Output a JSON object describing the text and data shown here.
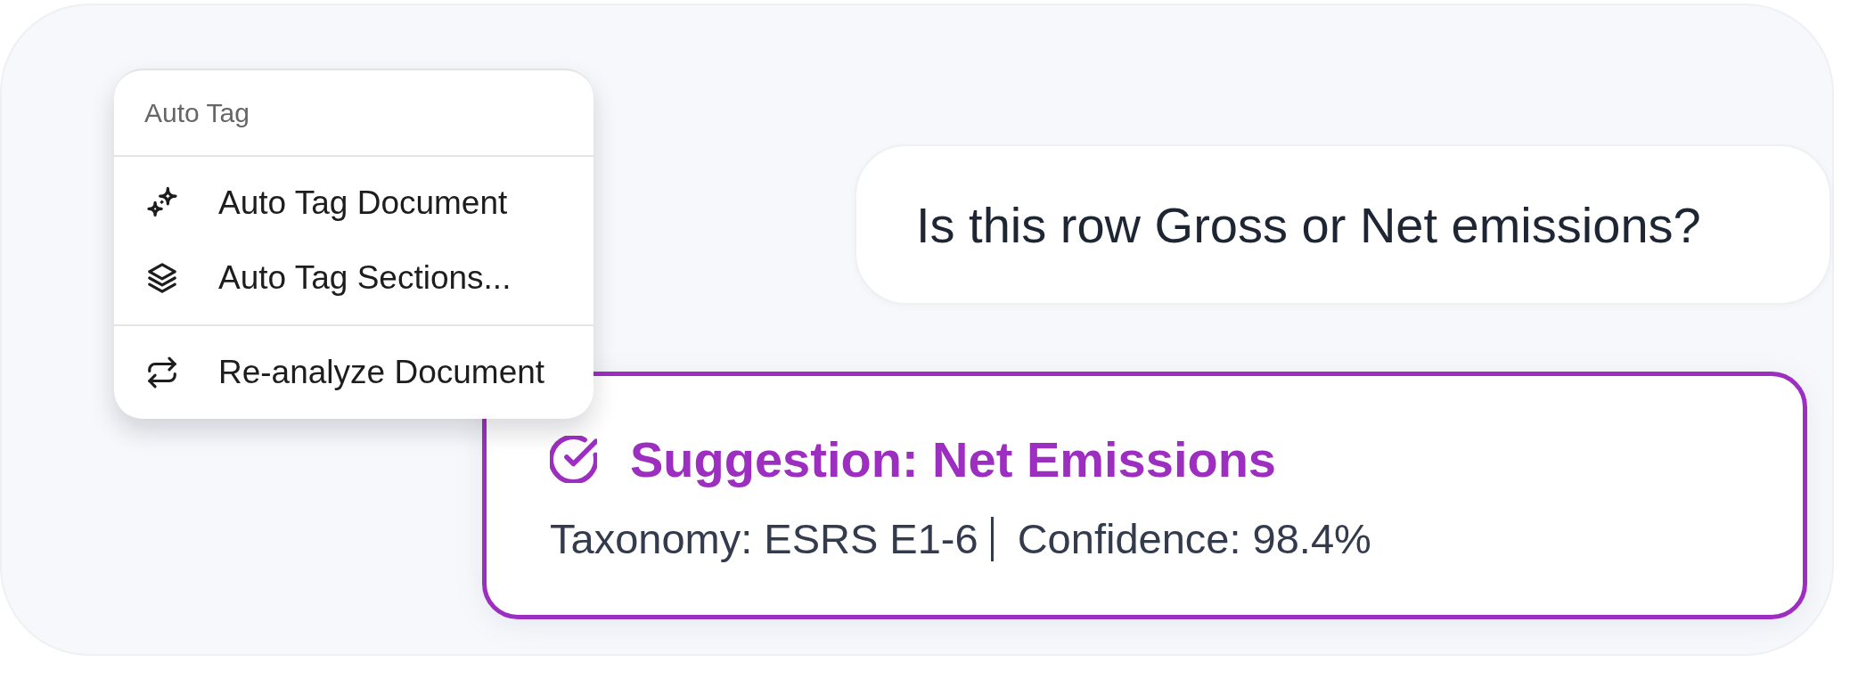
{
  "menu": {
    "header": "Auto Tag",
    "sections": [
      {
        "items": [
          {
            "label": "Auto Tag Document"
          },
          {
            "label": "Auto Tag Sections..."
          }
        ]
      },
      {
        "items": [
          {
            "label": "Re-analyze Document"
          }
        ]
      }
    ]
  },
  "question": {
    "text": "Is this row Gross or Net emissions?"
  },
  "suggestion": {
    "title": "Suggestion: Net Emissions",
    "taxonomy": "Taxonomy: ESRS E1-6",
    "confidence": "Confidence: 98.4%"
  }
}
